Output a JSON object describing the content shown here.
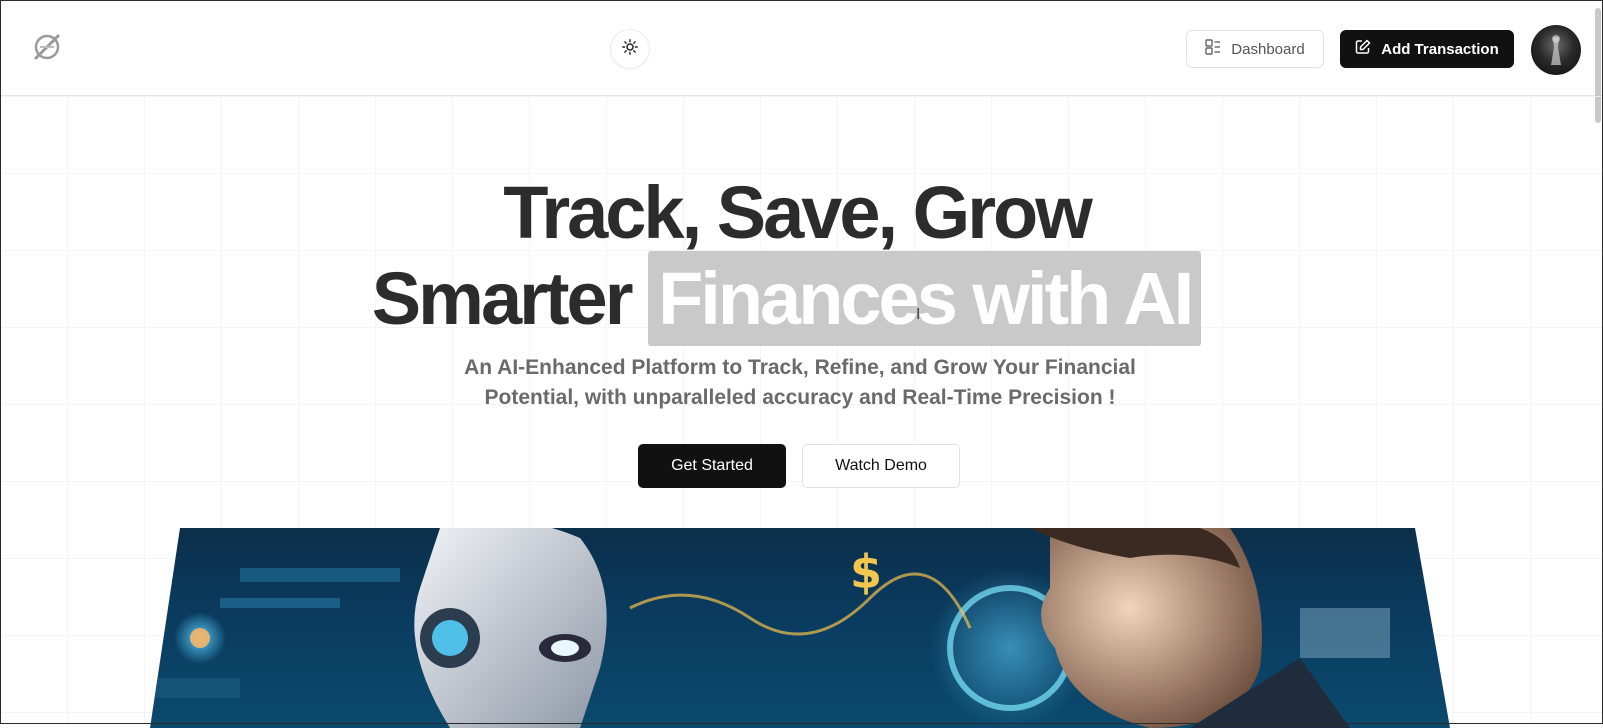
{
  "header": {
    "logo_icon": "logo-slash-icon",
    "theme_toggle_icon": "sun-icon",
    "dashboard_label": "Dashboard",
    "dashboard_icon": "dashboard-icon",
    "add_transaction_label": "Add Transaction",
    "add_transaction_icon": "pen-square-icon"
  },
  "hero": {
    "title_line1": "Track, Save, Grow",
    "title_line2_plain": "Smarter",
    "title_line2_highlight": "Finances with AI",
    "subtitle": "An AI-Enhanced Platform to Track, Refine, and Grow Your Financial Potential, with unparalleled accuracy and Real-Time Precision !",
    "primary_button": "Get Started",
    "secondary_button": "Watch Demo"
  },
  "colors": {
    "primary": "#111111",
    "highlight_bg": "#c9c9c9",
    "text_dark": "#2c2c2c",
    "text_muted": "#6a6a6a"
  }
}
